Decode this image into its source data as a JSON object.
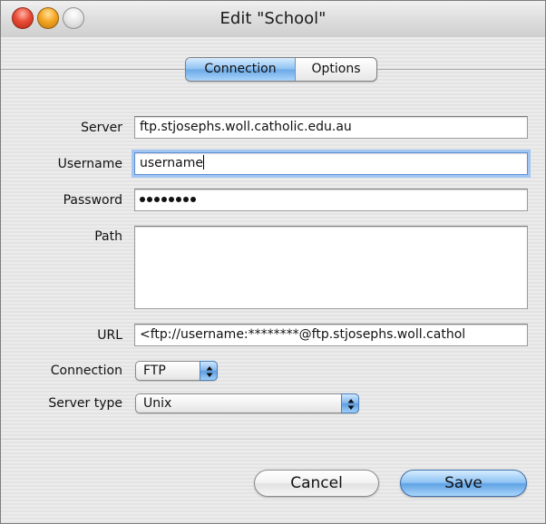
{
  "window": {
    "title": "Edit \"School\""
  },
  "tabs": [
    {
      "label": "Connection",
      "selected": true
    },
    {
      "label": "Options",
      "selected": false
    }
  ],
  "form": {
    "server": {
      "label": "Server",
      "value": "ftp.stjosephs.woll.catholic.edu.au"
    },
    "username": {
      "label": "Username",
      "value": "username"
    },
    "password": {
      "label": "Password",
      "masked_length": 8
    },
    "path": {
      "label": "Path",
      "value": ""
    },
    "url": {
      "label": "URL",
      "value": "<ftp://username:********@ftp.stjosephs.woll.cathol"
    },
    "connection": {
      "label": "Connection",
      "value": "FTP"
    },
    "server_type": {
      "label": "Server type",
      "value": "Unix"
    }
  },
  "buttons": {
    "cancel": "Cancel",
    "save": "Save"
  },
  "colors": {
    "accent": "#6aa9e7",
    "focus_ring": "#a3c5f2"
  }
}
